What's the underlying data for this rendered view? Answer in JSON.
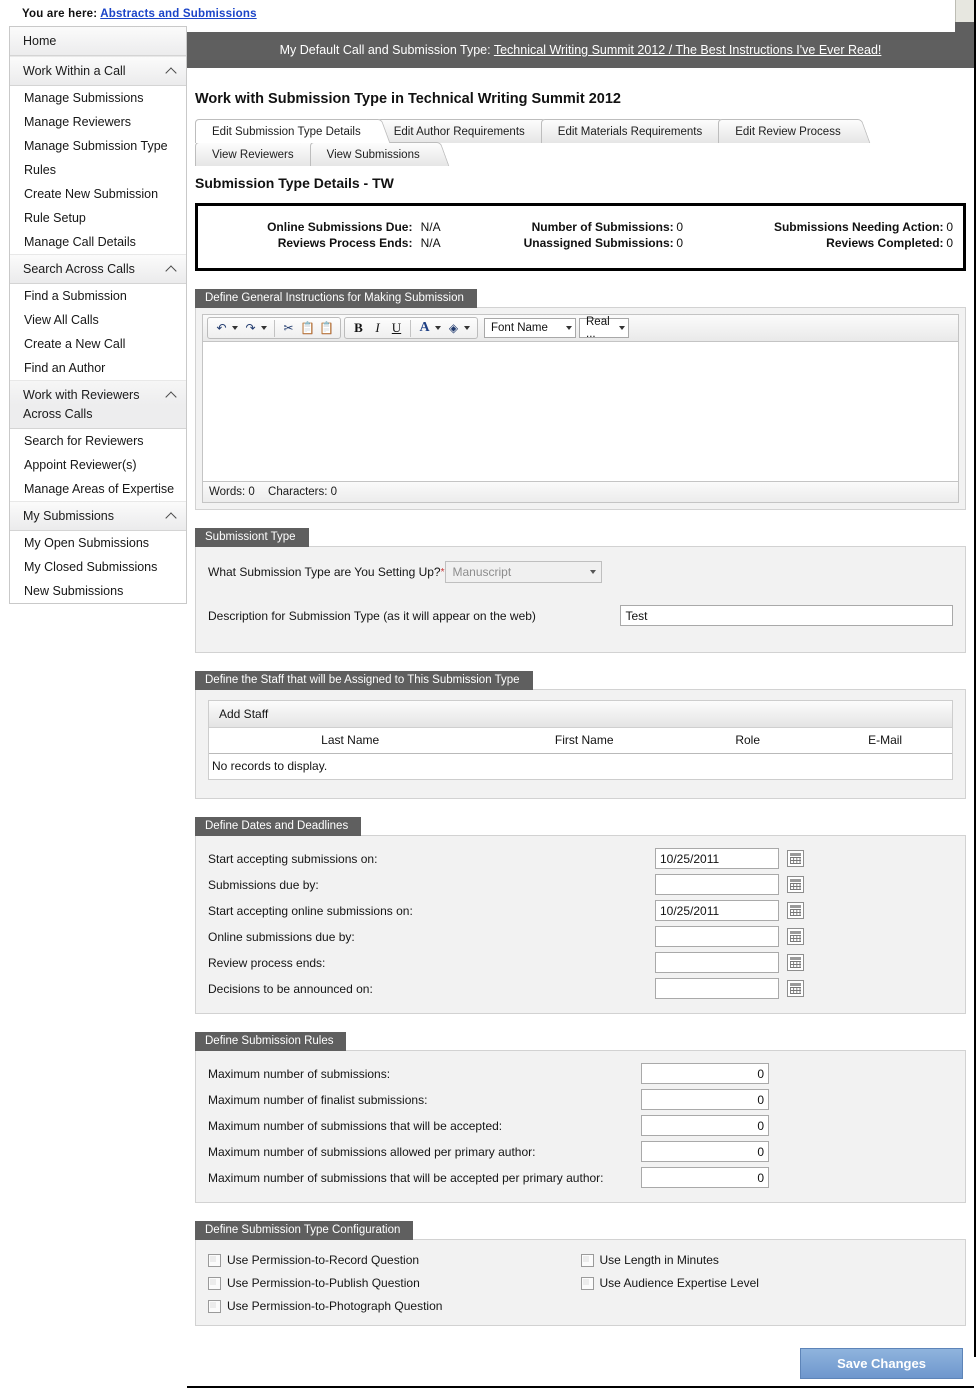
{
  "breadcrumb": {
    "prefix": "You are here:",
    "link": "Abstracts and Submissions"
  },
  "sidebar": {
    "home": "Home",
    "groups": [
      {
        "label": "Work Within a Call",
        "items": [
          "Manage Submissions",
          "Manage Reviewers",
          "Manage Submission Type",
          "Rules",
          "Create New Submission",
          "Rule Setup",
          "Manage Call Details"
        ]
      },
      {
        "label": "Search Across Calls",
        "items": [
          "Find a Submission",
          "View All Calls",
          "Create a New Call",
          "Find an Author"
        ]
      },
      {
        "label": "Work with Reviewers",
        "sublabel": "Across Calls",
        "items": [
          "Search for Reviewers",
          "Appoint Reviewer(s)",
          "Manage Areas of Expertise"
        ]
      },
      {
        "label": "My Submissions",
        "items": [
          "My Open Submissions",
          "My Closed Submissions",
          "New Submissions"
        ]
      }
    ]
  },
  "callbar": {
    "prefix": "My Default Call and Submission Type:",
    "link": "Technical Writing Summit 2012 / The Best Instructions I've Ever Read!"
  },
  "page": {
    "title": "Work with Submission Type in Technical Writing Summit 2012",
    "subtitle": "Submission Type Details - TW"
  },
  "tabs_row1": [
    {
      "label": "Edit Submission Type Details",
      "active": true
    },
    {
      "label": "Edit Author Requirements",
      "active": false
    },
    {
      "label": "Edit Materials Requirements",
      "active": false
    },
    {
      "label": "Edit Review Process",
      "active": false
    }
  ],
  "tabs_row2": [
    {
      "label": "View Reviewers",
      "active": false
    },
    {
      "label": "View Submissions",
      "active": false
    }
  ],
  "stats": [
    {
      "label": "Online Submissions Due:",
      "value": "N/A",
      "label2": "Number of Submissions:",
      "value2": "0",
      "label3": "Submissions Needing Action:",
      "value3": "0"
    },
    {
      "label": "Reviews Process Ends:",
      "value": "N/A",
      "label2": "Unassigned Submissions:",
      "value2": "0",
      "label3": "Reviews Completed:",
      "value3": "0"
    }
  ],
  "editor": {
    "panel_title": "Define General Instructions for Making Submission",
    "font_name": "Font Name",
    "font_size": "Real ...",
    "words": "Words: 0",
    "characters": "Characters: 0",
    "content": ""
  },
  "submission_type": {
    "panel_title": "Submissiont Type",
    "type_label": "What Submission Type are You Setting Up?",
    "type_value": "Manuscript",
    "desc_label": "Description for Submission Type (as it will appear on the web)",
    "desc_value": "Test"
  },
  "staff": {
    "panel_title": "Define the Staff that will be Assigned to This Submission Type",
    "add_label": "Add Staff",
    "columns": [
      "Last Name",
      "First Name",
      "Role",
      "E-Mail"
    ],
    "empty": "No records to display.",
    "rows": []
  },
  "dates": {
    "panel_title": "Define Dates and Deadlines",
    "rows": [
      {
        "label": "Start accepting submissions on:",
        "value": "10/25/2011"
      },
      {
        "label": "Submissions due by:",
        "value": ""
      },
      {
        "label": "Start accepting online submissions on:",
        "value": "10/25/2011"
      },
      {
        "label": "Online submissions due by:",
        "value": ""
      },
      {
        "label": "Review process ends:",
        "value": ""
      },
      {
        "label": "Decisions to be announced on:",
        "value": ""
      }
    ]
  },
  "rules": {
    "panel_title": "Define Submission Rules",
    "rows": [
      {
        "label": "Maximum number of submissions:",
        "value": "0"
      },
      {
        "label": "Maximum number of finalist submissions:",
        "value": "0"
      },
      {
        "label": "Maximum number of submissions that will be accepted:",
        "value": "0"
      },
      {
        "label": "Maximum number of submissions allowed per primary author:",
        "value": "0"
      },
      {
        "label": "Maximum number of submissions that will be accepted per primary author:",
        "value": "0"
      }
    ]
  },
  "config": {
    "panel_title": "Define Submission Type Configuration",
    "left": [
      "Use Permission-to-Record Question",
      "Use Permission-to-Publish Question",
      "Use Permission-to-Photograph Question"
    ],
    "right": [
      "Use Length in Minutes",
      "Use Audience Expertise Level"
    ]
  },
  "save_label": "Save Changes",
  "colors": {
    "accent": "#5f5f5f",
    "link": "#1b44c8",
    "button": "#7fa6d4",
    "required": "#c63030"
  }
}
